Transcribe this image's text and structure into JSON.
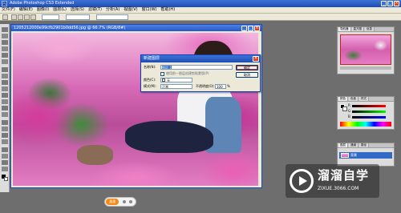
{
  "app": {
    "title": "Adobe Photoshop CS3 Extended",
    "icon_label": "Ps"
  },
  "window_controls": {
    "minimize": "_",
    "maximize": "□",
    "close": "×"
  },
  "menu": [
    "文件(F)",
    "编辑(E)",
    "图像(I)",
    "图层(L)",
    "选择(S)",
    "滤镜(T)",
    "分析(A)",
    "视图(V)",
    "窗口(W)",
    "帮助(H)"
  ],
  "document": {
    "title": "1205212000e99cfb2901b0dd56.jpg @ 66.7% (RGB/8#)"
  },
  "dialog": {
    "title": "新建图层",
    "close": "×",
    "name_label": "名称(N):",
    "name_value": "图层 1",
    "checkbox_label": "使用前一图层创建剪贴蒙版(P)",
    "color_label": "颜色(C):",
    "color_value": "无",
    "mode_label": "模式(M):",
    "mode_value": "正常",
    "opacity_label": "不透明度(O):",
    "opacity_value": "100",
    "opacity_unit": "%",
    "ok_label": "确定",
    "cancel_label": "取消"
  },
  "panels": {
    "navigator_tabs": [
      "导航器",
      "直方图",
      "信息"
    ],
    "color_tabs": [
      "颜色",
      "色板",
      "样式"
    ],
    "color_channels": [
      "R",
      "G",
      "B"
    ],
    "layers_tabs": [
      "图层",
      "通道",
      "路径"
    ],
    "layer_name": "背景"
  },
  "watermark": {
    "title": "溜溜自学",
    "url": "ZIXUE.3066.COM"
  },
  "bottom_pill": {
    "label": "溜溜"
  },
  "colors": {
    "titlebar": "#1c4db4",
    "menu_bg": "#ece9d8",
    "selection": "#316ac5",
    "close_red": "#d9421c",
    "pill_orange": "#f28a1a"
  }
}
